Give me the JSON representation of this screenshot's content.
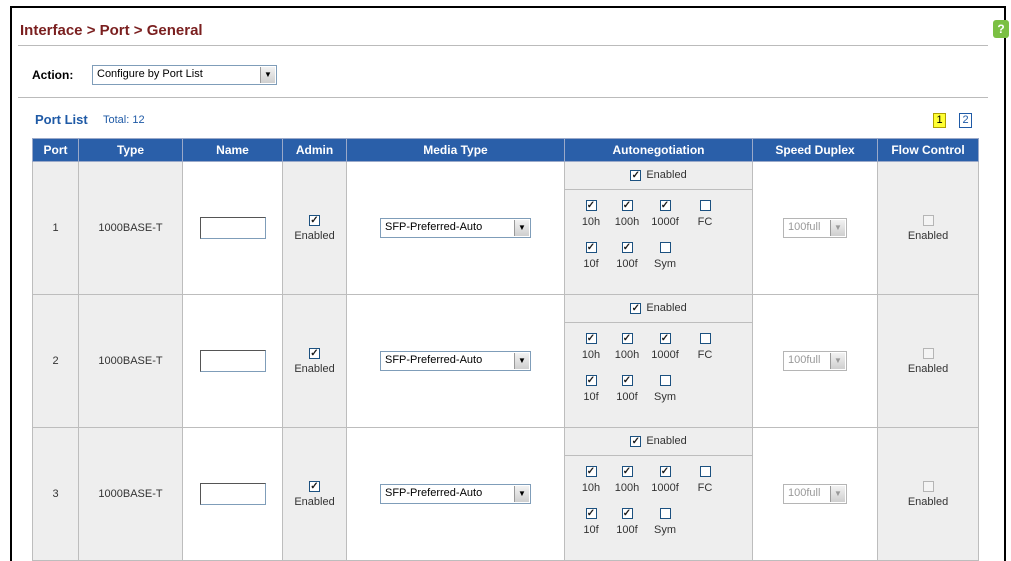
{
  "header": {
    "breadcrumb": "Interface > Port > General",
    "help_icon": "help-icon"
  },
  "action": {
    "label": "Action:",
    "selected": "Configure by Port List"
  },
  "port_list": {
    "title": "Port List",
    "total": "Total: 12",
    "pages": [
      "1",
      "2"
    ],
    "active_page": "1"
  },
  "columns": [
    "Port",
    "Type",
    "Name",
    "Admin",
    "Media Type",
    "Autonegotiation",
    "Speed Duplex",
    "Flow Control"
  ],
  "rows": [
    {
      "port": "1",
      "type": "1000BASE-T",
      "name": "",
      "admin_checked": true,
      "admin_label": "Enabled",
      "media_type": "SFP-Preferred-Auto",
      "auto": {
        "enabled_checked": true,
        "enabled_label": "Enabled",
        "options": [
          {
            "label": "10h",
            "checked": true
          },
          {
            "label": "100h",
            "checked": true
          },
          {
            "label": "1000f",
            "checked": true
          },
          {
            "label": "FC",
            "checked": false
          },
          {
            "label": "10f",
            "checked": true
          },
          {
            "label": "100f",
            "checked": true
          },
          {
            "label": "Sym",
            "checked": false
          }
        ]
      },
      "speed_duplex": "100full",
      "flow_checked": false,
      "flow_label": "Enabled"
    },
    {
      "port": "2",
      "type": "1000BASE-T",
      "name": "",
      "admin_checked": true,
      "admin_label": "Enabled",
      "media_type": "SFP-Preferred-Auto",
      "auto": {
        "enabled_checked": true,
        "enabled_label": "Enabled",
        "options": [
          {
            "label": "10h",
            "checked": true
          },
          {
            "label": "100h",
            "checked": true
          },
          {
            "label": "1000f",
            "checked": true
          },
          {
            "label": "FC",
            "checked": false
          },
          {
            "label": "10f",
            "checked": true
          },
          {
            "label": "100f",
            "checked": true
          },
          {
            "label": "Sym",
            "checked": false
          }
        ]
      },
      "speed_duplex": "100full",
      "flow_checked": false,
      "flow_label": "Enabled"
    },
    {
      "port": "3",
      "type": "1000BASE-T",
      "name": "",
      "admin_checked": true,
      "admin_label": "Enabled",
      "media_type": "SFP-Preferred-Auto",
      "auto": {
        "enabled_checked": true,
        "enabled_label": "Enabled",
        "options": [
          {
            "label": "10h",
            "checked": true
          },
          {
            "label": "100h",
            "checked": true
          },
          {
            "label": "1000f",
            "checked": true
          },
          {
            "label": "FC",
            "checked": false
          },
          {
            "label": "10f",
            "checked": true
          },
          {
            "label": "100f",
            "checked": true
          },
          {
            "label": "Sym",
            "checked": false
          }
        ]
      },
      "speed_duplex": "100full",
      "flow_checked": false,
      "flow_label": "Enabled"
    }
  ],
  "colors": {
    "header_bg": "#2a5fa9",
    "breadcrumb": "#7a1f1f",
    "link": "#1f5aa6",
    "active_page": "#ffff33"
  }
}
